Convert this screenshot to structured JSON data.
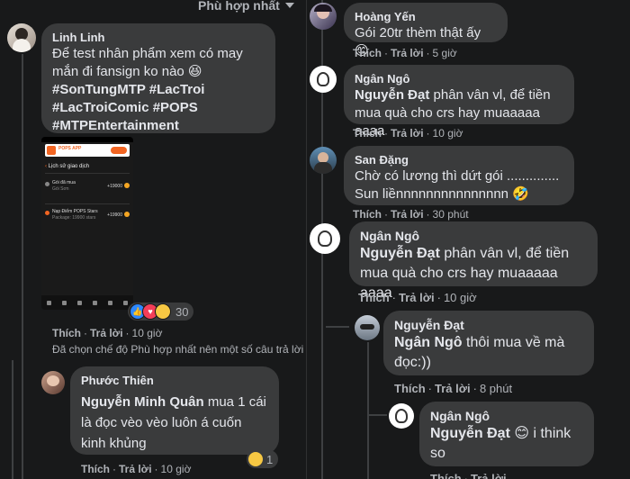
{
  "sort": {
    "label": "Phù hợp nhất"
  },
  "left": {
    "c1": {
      "name": "Linh Linh",
      "lines": [
        "Để test nhân phẩm xem có may",
        "mắn đi fansign ko nào 😆",
        "#SonTungMTP #LacTroi",
        "#LacTroiComic #POPS",
        "#MTPEntertainment"
      ],
      "like": "Thích",
      "reply": "Trả lời",
      "time": "10 giờ",
      "reactions_count": "30",
      "note": "Đã chọn chế độ Phù hợp nhất nên một số câu trả lời c"
    },
    "attachment": {
      "app_name": "POPS APP",
      "header_title": "Lịch sử giao dịch",
      "row1_title": "Gói đã mua",
      "row1_sub": "Gói Sơn",
      "row1_value": "+19000",
      "row2_title": "Nạp Điểm POPS Stars",
      "row2_sub": "Package: 19900 stars",
      "row2_value": "+19900"
    },
    "c2": {
      "name": "Phước Thiên",
      "mention": "Nguyễn Minh Quân",
      "lines": [
        "mua 1 cái",
        "là đọc vèo vèo luôn á cuốn",
        "kinh khủng"
      ],
      "like": "Thích",
      "reply": "Trả lời",
      "time": "10 giờ",
      "reactions_count": "1"
    }
  },
  "right": {
    "c1": {
      "name": "Hoàng Yến",
      "text": "Gói 20tr thèm thật ấy 😊",
      "like": "Thích",
      "reply": "Trả lời",
      "time": "5 giờ"
    },
    "c2": {
      "name": "Ngân Ngô",
      "mention": "Nguyễn Đạt",
      "lines": [
        "phân vân vl, để tiền",
        "mua quà cho crs hay muaaaaa aaaa"
      ],
      "like": "Thích",
      "reply": "Trả lời",
      "time": "10 giờ"
    },
    "c3": {
      "name": "San Đặng",
      "lines": [
        "Chờ có lương thì dứt gói ..............",
        "Sun liềnnnnnnnnnnnnnnn 🤣"
      ],
      "like": "Thích",
      "reply": "Trả lời",
      "time": "30 phút"
    },
    "c4": {
      "name": "Ngân Ngô",
      "mention": "Nguyễn Đạt",
      "lines": [
        "phân vân vl, để tiền",
        "mua quà cho crs hay muaaaaa aaaa"
      ],
      "like": "Thích",
      "reply": "Trả lời",
      "time": "10 giờ"
    },
    "c5": {
      "name": "Nguyễn Đạt",
      "mention": "Ngân Ngô",
      "lines": [
        "thôi mua về mà",
        "đọc:))"
      ],
      "like": "Thích",
      "reply": "Trả lời",
      "time": "8 phút"
    },
    "c6": {
      "name": "Ngân Ngô",
      "mention": "Nguyễn Đạt",
      "lines": [
        "😊 i think",
        "so"
      ],
      "like": "Thích",
      "reply": "Trả lời",
      "time": ""
    }
  },
  "colors": {
    "background": "#18191a",
    "bubble": "#3a3b3c",
    "text": "#e4e6eb",
    "muted": "#b0b3b8",
    "pops_orange": "#f26522"
  },
  "icons": [
    "chevron-down-icon",
    "like-reaction-icon",
    "love-reaction-icon",
    "haha-reaction-icon",
    "avatar-icons"
  ]
}
